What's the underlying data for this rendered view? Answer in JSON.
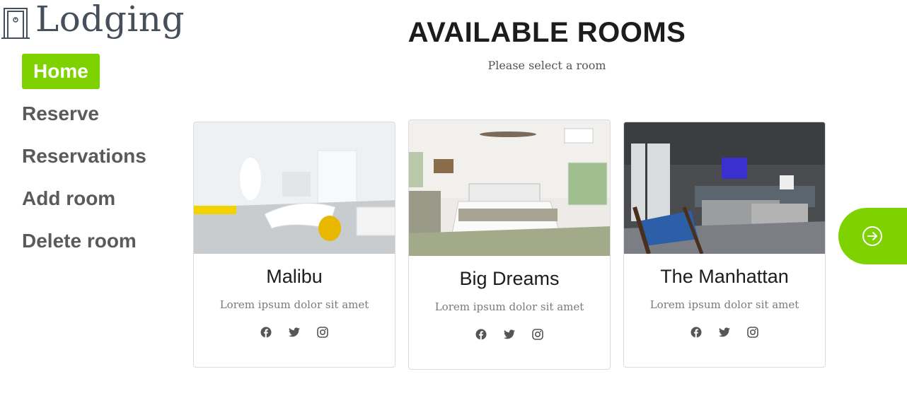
{
  "brand": {
    "name": "Lodging",
    "accent_color": "#7ed200"
  },
  "nav": {
    "items": [
      {
        "label": "Home",
        "active": true
      },
      {
        "label": "Reserve",
        "active": false
      },
      {
        "label": "Reservations",
        "active": false
      },
      {
        "label": "Add room",
        "active": false
      },
      {
        "label": "Delete room",
        "active": false
      }
    ]
  },
  "header": {
    "title": "AVAILABLE ROOMS",
    "subtitle": "Please select a room"
  },
  "rooms": [
    {
      "name": "Malibu",
      "description": "Lorem ipsum dolor sit amet",
      "socials": [
        "facebook-icon",
        "twitter-icon",
        "instagram-icon"
      ]
    },
    {
      "name": "Big Dreams",
      "description": "Lorem ipsum dolor sit amet",
      "socials": [
        "facebook-icon",
        "twitter-icon",
        "instagram-icon"
      ]
    },
    {
      "name": "The Manhattan",
      "description": "Lorem ipsum dolor sit amet",
      "socials": [
        "facebook-icon",
        "twitter-icon",
        "instagram-icon"
      ]
    }
  ],
  "carousel": {
    "next_icon": "arrow-right-circle-icon"
  }
}
